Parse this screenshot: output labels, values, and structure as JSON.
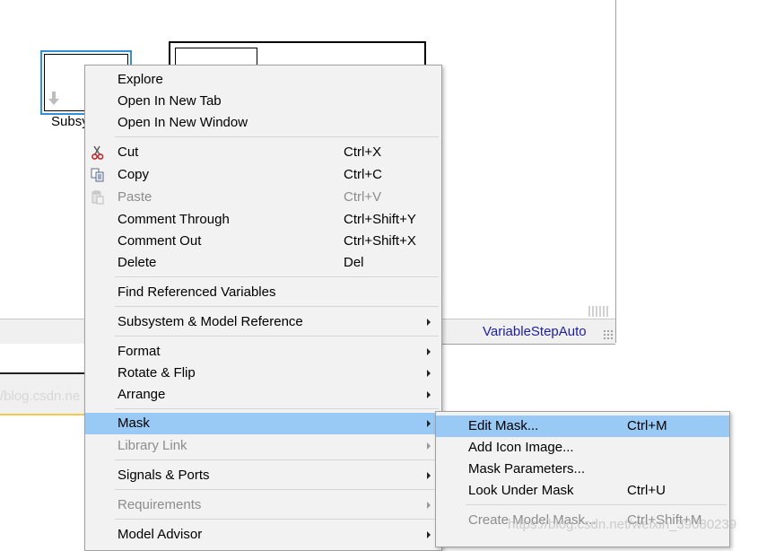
{
  "canvas": {
    "block_label": "Subsy",
    "solver_status": "VariableStepAuto",
    "faint_text": "/blog.csdn.ne"
  },
  "menu": {
    "items": [
      {
        "label": "Explore"
      },
      {
        "label": "Open In New Tab"
      },
      {
        "label": "Open In New Window"
      },
      {
        "label": "Cut",
        "shortcut": "Ctrl+X",
        "icon": "scissors-icon"
      },
      {
        "label": "Copy",
        "shortcut": "Ctrl+C",
        "icon": "copy-icon"
      },
      {
        "label": "Paste",
        "shortcut": "Ctrl+V",
        "icon": "paste-icon",
        "disabled": true
      },
      {
        "label": "Comment Through",
        "shortcut": "Ctrl+Shift+Y"
      },
      {
        "label": "Comment Out",
        "shortcut": "Ctrl+Shift+X"
      },
      {
        "label": "Delete",
        "shortcut": "Del"
      },
      {
        "label": "Find Referenced Variables"
      },
      {
        "label": "Subsystem & Model Reference",
        "submenu": true
      },
      {
        "label": "Format",
        "submenu": true
      },
      {
        "label": "Rotate & Flip",
        "submenu": true
      },
      {
        "label": "Arrange",
        "submenu": true
      },
      {
        "label": "Mask",
        "submenu": true,
        "highlighted": true
      },
      {
        "label": "Library Link",
        "submenu": true,
        "disabled": true
      },
      {
        "label": "Signals & Ports",
        "submenu": true
      },
      {
        "label": "Requirements",
        "submenu": true,
        "disabled": true
      },
      {
        "label": "Model Advisor",
        "submenu": true
      }
    ]
  },
  "submenu": {
    "items": [
      {
        "label": "Edit Mask...",
        "shortcut": "Ctrl+M",
        "highlighted": true
      },
      {
        "label": "Add Icon Image..."
      },
      {
        "label": "Mask Parameters..."
      },
      {
        "label": "Look Under Mask",
        "shortcut": "Ctrl+U"
      },
      {
        "label": "Create Model Mask...",
        "shortcut": "Ctrl+Shift+M",
        "disabled": true
      }
    ]
  },
  "watermark": "https://blog.csdn.net/weixin_39080239",
  "colors": {
    "highlight": "#99c9f5",
    "selection_border": "#2f90e0",
    "solver_text": "#1e1ea0"
  }
}
